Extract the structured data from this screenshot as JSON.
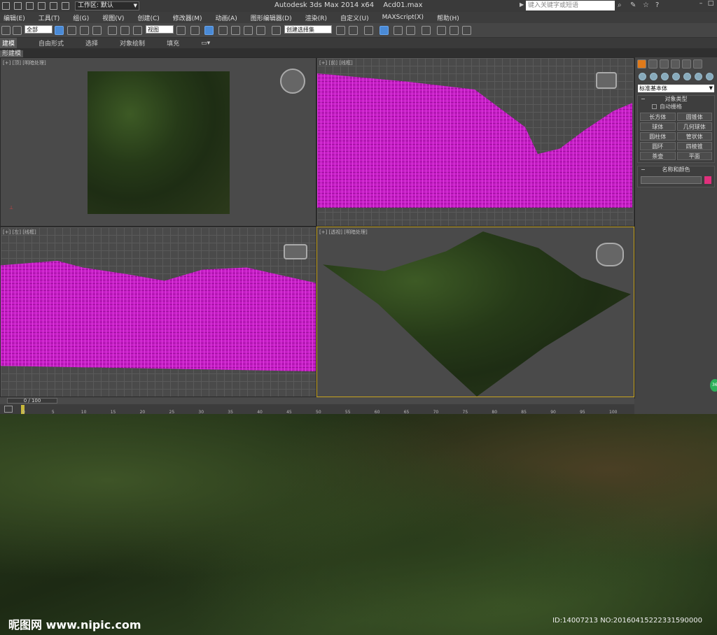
{
  "titlebar": {
    "workspace": "工作区: 默认",
    "app_title": "Autodesk 3ds Max  2014 x64",
    "file_name": "Acd01.max",
    "search_placeholder": "键入关键字或短语"
  },
  "menus": [
    "编辑(E)",
    "工具(T)",
    "组(G)",
    "视图(V)",
    "创建(C)",
    "修改器(M)",
    "动画(A)",
    "图形编辑器(D)",
    "渲染(R)",
    "自定义(U)",
    "MAXScript(X)",
    "帮助(H)"
  ],
  "toolbar": {
    "selection_filter": "全部",
    "ref_coord": "视图",
    "named_selection": "创建选择集"
  },
  "ribbon": {
    "tabs": [
      "建模",
      "自由形式",
      "选择",
      "对象绘制",
      "填充"
    ],
    "sub_label": "形建模"
  },
  "viewports": {
    "top": "[+] [顶] [明暗处理]",
    "front": "[+] [前] [线框]",
    "left": "[+] [左] [线框]",
    "persp": "[+] [透视] [明暗处理]"
  },
  "command_panel": {
    "category": "标准基本体",
    "object_type_header": "对象类型",
    "auto_grid": "自动栅格",
    "buttons": [
      "长方体",
      "圆锥体",
      "球体",
      "几何球体",
      "圆柱体",
      "管状体",
      "圆环",
      "四棱锥",
      "茶壶",
      "平面"
    ],
    "name_color_header": "名称和颜色",
    "object_color": "#e0307c"
  },
  "timeline": {
    "frame": "0 / 100",
    "ticks": [
      "0",
      "5",
      "10",
      "15",
      "20",
      "25",
      "30",
      "35",
      "40",
      "45",
      "50",
      "55",
      "60",
      "65",
      "70",
      "75",
      "80",
      "85",
      "90",
      "95",
      "100"
    ]
  },
  "watermark": {
    "logo": "昵图网 www.nipic.com",
    "id_text": "ID:14007213 NO:20160415222331590000"
  },
  "badge": "36"
}
